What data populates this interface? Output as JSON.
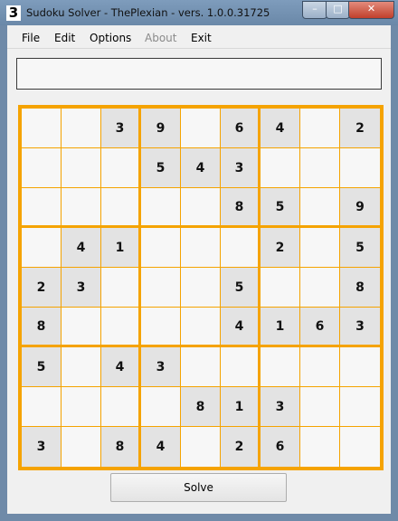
{
  "window": {
    "title": "Sudoku Solver - ThePlexian - vers. 1.0.0.31725",
    "icon_glyph": "3"
  },
  "controls": {
    "minimize": "–",
    "maximize": "□",
    "close": "✕"
  },
  "menu": [
    {
      "label": "File",
      "enabled": true
    },
    {
      "label": "Edit",
      "enabled": true
    },
    {
      "label": "Options",
      "enabled": true
    },
    {
      "label": "About",
      "enabled": false
    },
    {
      "label": "Exit",
      "enabled": true
    }
  ],
  "input": {
    "value": ""
  },
  "grid": [
    [
      "",
      "",
      "3",
      "9",
      "",
      "6",
      "4",
      "",
      "2"
    ],
    [
      "",
      "",
      "",
      "5",
      "4",
      "3",
      "",
      "",
      ""
    ],
    [
      "",
      "",
      "",
      "",
      "",
      "8",
      "5",
      "",
      "9"
    ],
    [
      "",
      "4",
      "1",
      "",
      "",
      "",
      "2",
      "",
      "5"
    ],
    [
      "2",
      "3",
      "",
      "",
      "",
      "5",
      "",
      "",
      "8"
    ],
    [
      "8",
      "",
      "",
      "",
      "",
      "4",
      "1",
      "6",
      "3"
    ],
    [
      "5",
      "",
      "4",
      "3",
      "",
      "",
      "",
      "",
      ""
    ],
    [
      "",
      "",
      "",
      "",
      "8",
      "1",
      "3",
      "",
      ""
    ],
    [
      "3",
      "",
      "8",
      "4",
      "",
      "2",
      "6",
      "",
      ""
    ]
  ],
  "solve_button": {
    "label": "Solve"
  },
  "colors": {
    "grid_accent": "#f5a300",
    "given_cell": "#e3e3e3",
    "empty_cell": "#f7f7f7"
  }
}
